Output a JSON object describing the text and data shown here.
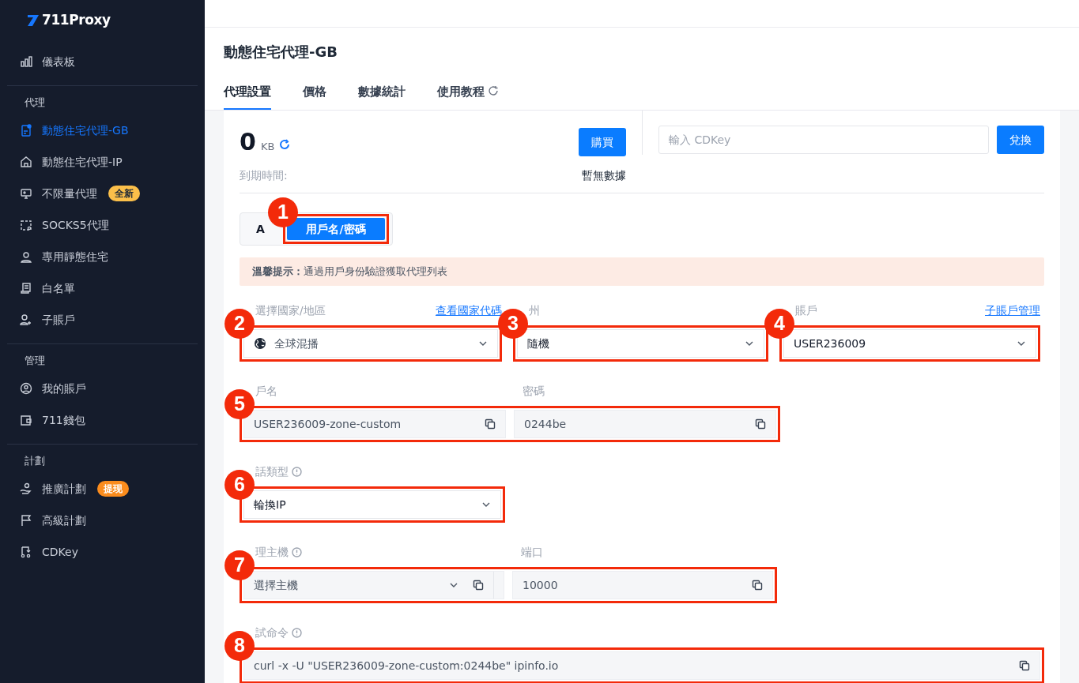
{
  "logo": {
    "text": "711Proxy"
  },
  "sidebar": {
    "sections": [
      {
        "items": [
          {
            "label": "儀表板",
            "selected": false
          }
        ]
      },
      {
        "heading": "代理",
        "items": [
          {
            "label": "動態住宅代理-GB",
            "selected": true
          },
          {
            "label": "動態住宅代理-IP",
            "selected": false
          },
          {
            "label": "不限量代理",
            "selected": false,
            "badge": {
              "text": "全新",
              "color": "#fbbf4a"
            }
          },
          {
            "label": "SOCKS5代理",
            "selected": false
          },
          {
            "label": "專用靜態住宅",
            "selected": false
          },
          {
            "label": "白名單",
            "selected": false
          },
          {
            "label": "子賬戶",
            "selected": false
          }
        ]
      },
      {
        "heading": "管理",
        "items": [
          {
            "label": "我的賬戶",
            "selected": false
          },
          {
            "label": "711錢包",
            "selected": false
          }
        ]
      },
      {
        "heading": "計劃",
        "items": [
          {
            "label": "推廣計劃",
            "selected": false,
            "badge": {
              "text": "提现",
              "color": "#fb8c1d"
            }
          },
          {
            "label": "高級計劃",
            "selected": false
          },
          {
            "label": "CDKey",
            "selected": false
          }
        ]
      }
    ]
  },
  "page_title": "動態住宅代理-GB",
  "tabs": [
    {
      "label": "代理設置",
      "selected": true,
      "external": false
    },
    {
      "label": "價格",
      "selected": false,
      "external": false
    },
    {
      "label": "數據統計",
      "selected": false,
      "external": false
    },
    {
      "label": "使用教程",
      "selected": false,
      "external": true
    }
  ],
  "traffic": {
    "value": "0",
    "unit": "KB",
    "button": "購買",
    "expiry_label": "到期時間:",
    "expiry_value": "暫無數據"
  },
  "cdkey": {
    "placeholder": "輸入 CDKey",
    "button": "兌換"
  },
  "auth": {
    "badge": "1",
    "modes": [
      {
        "label": "A",
        "selected": false
      },
      {
        "label": "用戶名/密碼",
        "selected": true
      }
    ]
  },
  "tip": "**溫馨提示：**通過用戶身份驗證獲取代理列表",
  "form_rows": [
    {
      "groups": [
        {
          "badge": "2",
          "fields": [
            {
              "kind": "region-select",
              "label": "選擇國家/地區",
              "info": false,
              "link": "查看國家代碼",
              "value": "全球混播"
            }
          ]
        },
        {
          "badge": "3",
          "fields": [
            {
              "kind": "select",
              "label": "州",
              "info": false,
              "value": "隨機"
            }
          ]
        },
        {
          "badge": "4",
          "fields": [
            {
              "kind": "select",
              "label": "賬戶",
              "info": false,
              "link": "子賬戶管理",
              "value": "USER236009"
            }
          ]
        }
      ]
    },
    {
      "groups": [
        {
          "badge": "5",
          "fields": [
            {
              "kind": "copy",
              "label": "戶名",
              "info": false,
              "value": "USER236009-zone-custom"
            },
            {
              "kind": "copy",
              "label": "密碼",
              "info": false,
              "value": "0244be"
            }
          ]
        }
      ]
    },
    {
      "groups": [
        {
          "badge": "6",
          "fields": [
            {
              "kind": "select",
              "label": "話類型",
              "info": true,
              "value": "輪換IP"
            }
          ]
        }
      ]
    },
    {
      "groups": [
        {
          "badge": "7",
          "fields": [
            {
              "kind": "select-copy",
              "label": "理主機",
              "info": true,
              "value": "選擇主機"
            },
            {
              "kind": "copy",
              "label": "端口",
              "info": false,
              "value": "10000"
            }
          ]
        }
      ]
    },
    {
      "groups": [
        {
          "badge": "8",
          "fields": [
            {
              "kind": "copy",
              "label": "試命令",
              "info": true,
              "value": "curl -x  -U \"USER236009-zone-custom:0244be\" ipinfo.io"
            }
          ]
        }
      ]
    }
  ]
}
